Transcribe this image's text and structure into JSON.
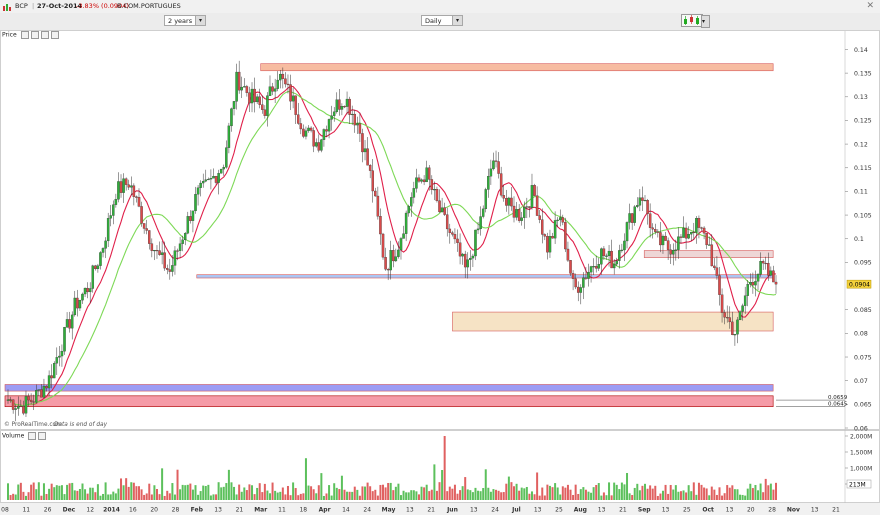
{
  "header": {
    "ticker": "BCP",
    "date": "27-Oct-2014",
    "change": "-3.83% (0.0904)",
    "exchange": "B.COM.PORTUGUES",
    "change_color": "#cc0000"
  },
  "controls": {
    "period": "2 years",
    "interval": "Daily",
    "chart_type_icon": "candlestick-chart-icon",
    "close_icon": "close-icon"
  },
  "price_panel": {
    "label": "Price",
    "watermark": "© ProRealTime.com",
    "watermark_note": "Data is end of day",
    "current_price_label": "0.0904",
    "level_labels": [
      "0.0659",
      "0.0645"
    ]
  },
  "volume_panel": {
    "label": "Volume",
    "y_ticks": [
      "2,000M",
      "1,500M",
      "1,000M",
      "500M"
    ],
    "current_volume_label": "213M"
  },
  "chart_data": {
    "type": "candlestick",
    "y_ticks": [
      "0.14",
      "0.135",
      "0.13",
      "0.125",
      "0.12",
      "0.115",
      "0.11",
      "0.105",
      "0.1",
      "0.095",
      "0.085",
      "0.08",
      "0.075",
      "0.07",
      "0.065",
      "0.06"
    ],
    "ylim": [
      0.06,
      0.142
    ],
    "x_ticks": [
      "08",
      "11",
      "26",
      "Dec",
      "12",
      "2014",
      "16",
      "20",
      "28",
      "Feb",
      "13",
      "21",
      "Mar",
      "11",
      "18",
      "Apr",
      "14",
      "24",
      "May",
      "13",
      "21",
      "Jun",
      "13",
      "24",
      "Jul",
      "13",
      "25",
      "Aug",
      "13",
      "21",
      "Sep",
      "13",
      "25",
      "Oct",
      "13",
      "20",
      "28",
      "Nov",
      "13",
      "21"
    ],
    "moving_averages": [
      {
        "color": "#e0204a"
      },
      {
        "color": "#7ed957"
      }
    ],
    "zones": [
      {
        "color": "#f4a582",
        "ymin": 0.1355,
        "ymax": 0.137,
        "xstart": "Mar",
        "xend": "Oct"
      },
      {
        "color": "#8fb3f0",
        "ymin": 0.0917,
        "ymax": 0.0924,
        "xstart": "Feb",
        "xend": "Oct"
      },
      {
        "color": "#f3d9b1",
        "ymin": 0.0805,
        "ymax": 0.0845,
        "xstart": "Jun",
        "xend": "Oct"
      },
      {
        "color": "#e8c8c8",
        "ymin": 0.096,
        "ymax": 0.0975,
        "xstart": "Sep",
        "xend": "Oct"
      },
      {
        "color": "#7b7bf0",
        "ymin": 0.0678,
        "ymax": 0.0692,
        "xstart": "08",
        "xend": "Oct"
      },
      {
        "color": "#f27a8a",
        "ymin": 0.0645,
        "ymax": 0.0668,
        "xstart": "08",
        "xend": "Oct"
      }
    ],
    "close_path": [
      0.066,
      0.0645,
      0.0665,
      0.07,
      0.078,
      0.086,
      0.09,
      0.098,
      0.11,
      0.112,
      0.104,
      0.097,
      0.093,
      0.101,
      0.109,
      0.112,
      0.116,
      0.134,
      0.13,
      0.127,
      0.135,
      0.13,
      0.123,
      0.12,
      0.127,
      0.13,
      0.124,
      0.112,
      0.094,
      0.099,
      0.11,
      0.114,
      0.106,
      0.1,
      0.093,
      0.103,
      0.117,
      0.107,
      0.105,
      0.11,
      0.098,
      0.105,
      0.089,
      0.093,
      0.097,
      0.095,
      0.103,
      0.11,
      0.1,
      0.098,
      0.1,
      0.103,
      0.099,
      0.085,
      0.08,
      0.091,
      0.094,
      0.0904
    ]
  }
}
